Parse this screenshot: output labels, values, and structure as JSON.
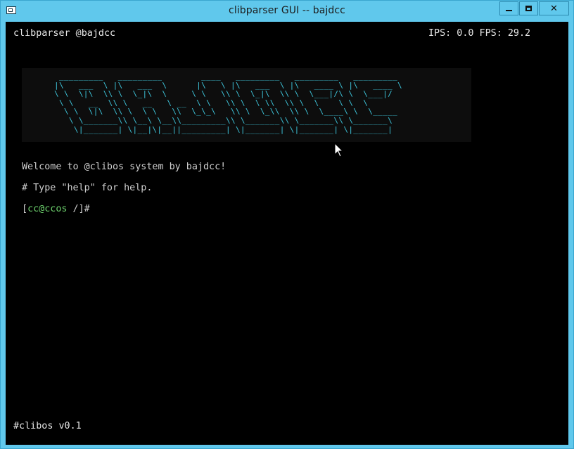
{
  "window": {
    "title": "clibparser GUI -- bajdcc",
    "controls": {
      "minimize": "minimize",
      "maximize": "maximize",
      "close": "✕"
    }
  },
  "terminal": {
    "header_left": "clibparser @bajdcc",
    "header_right": "IPS: 0.0 FPS: 29.2",
    "banner_art": "  _________   _________        ____   _________   _________   _________\n |\\   ___  \\ |\\   ___  \\      |\\   \\ |\\   ___  \\ |\\   ____ \\ |\\   ____ \\\n \\ \\  \\|\\  \\\\ \\  \\_|\\  \\     \\ \\   \\\\ \\  \\_|\\  \\\\ \\  \\___|/\\ \\  \\___|/\n  \\ \\   __  \\\\ \\   __   \\ __  \\ \\   \\\\ \\  \\ \\\\  \\\\ \\  \\    \\ \\  \\\n   \\ \\  \\|\\  \\\\ \\  \\ \\   \\\\  \\_\\_\\   \\\\ \\  \\_\\\\  \\\\ \\  \\____\\ \\  \\_____\n    \\ \\_______\\\\ \\__\\ \\__\\\\_________\\\\ \\_______\\\\ \\_______\\\\ \\_______\\\n     \\|_______| \\|__|\\|__||_________| \\|_______| \\|_______| \\|_______|",
    "welcome": "Welcome to @clibos system by bajdcc!",
    "help": "# Type \"help\" for help.",
    "prompt": {
      "open": "[",
      "host": "cc@ccos",
      "path": " /]#"
    },
    "footer": "#clibos v0.1"
  },
  "colors": {
    "titlebar": "#60c8ec",
    "terminal_bg": "#000000",
    "banner": "#3ec6dc",
    "prompt_host": "#6ed36e"
  }
}
